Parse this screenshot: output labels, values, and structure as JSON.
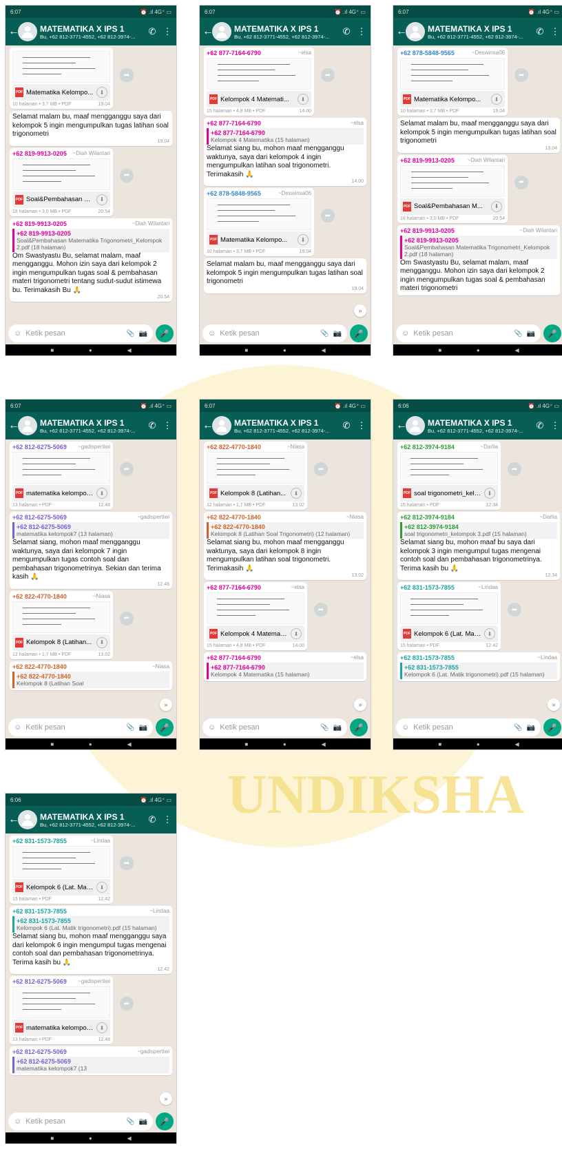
{
  "watermark": {
    "text": "UNDIKSHA",
    "color": "#f6df88"
  },
  "common": {
    "title": "MATEMATIKA X IPS 1",
    "subtitle": "Bu, +62 812-3771-4552, +62 812-3974-...",
    "input_placeholder": "Ketik pesan",
    "status_time": "6:07",
    "status_right": "⏰ .ıl 4G⁺ ▭"
  },
  "phones": [
    {
      "status_time": "6:07",
      "messages": [
        {
          "kind": "doc",
          "color": "#e07000",
          "sender": "",
          "alias": "",
          "doc": "Matematika Kelompo...",
          "meta": "10 halaman • 3,7 MB • PDF",
          "time": "19.04"
        },
        {
          "kind": "text",
          "text": "Selamat malam bu, maaf mengganggu saya dari kelompok 5 ingin mengumpulkan tugas latihan soal trigonometri",
          "time": "19.04"
        },
        {
          "kind": "doc",
          "color": "#e0009a",
          "sender": "+62 819-9913-0205",
          "alias": "~Diah Wilantari",
          "doc": "Soal&Pembahasan M...",
          "meta": "18 halaman • 3,0 MB • PDF",
          "time": "20.54"
        },
        {
          "kind": "reply",
          "color": "#e0009a",
          "sender": "+62 819-9913-0205",
          "alias": "~Diah Wilantari",
          "q_sender": "+62 819-9913-0205",
          "q_text": "Soal&Pembahasan Matematika Trigonometri_Kelompok 2.pdf (18 halaman)",
          "text": "Om Swastyastu Bu, selamat malam, maaf mengganggu. Mohon izin saya dari kelompok 2 ingin mengumpulkan tugas soal & pembahasan materi trigonometri tentang sudut-sudut istimewa bu. Terimakasih Bu 🙏",
          "time": "20.54"
        }
      ]
    },
    {
      "status_time": "6:07",
      "messages": [
        {
          "kind": "doc",
          "color": "#e0009a",
          "sender": "+62 877-7164-6790",
          "alias": "~elsa",
          "doc": "Kelompok 4 Matemati...",
          "meta": "15 halaman • 4,8 MB • PDF",
          "time": "14.00"
        },
        {
          "kind": "reply",
          "color": "#e0009a",
          "sender": "+62 877-7164-6790",
          "alias": "~elsa",
          "q_sender": "+62 877-7164-6790",
          "q_text": "Kelompok 4 Matematika (15 halaman)",
          "text": "Selamat siang bu, mohon maaf mengganggu waktunya, saya dari kelompok 4 ingin mengumpulkan latihan soal trigonometri. Terimakasih 🙏",
          "time": "14.00"
        },
        {
          "kind": "doc",
          "color": "#3a86c8",
          "sender": "+62 878-5848-9565",
          "alias": "~Deswinsa06",
          "doc": "Matematika Kelompo...",
          "meta": "10 halaman • 3,7 MB • PDF",
          "time": "19.04"
        },
        {
          "kind": "text",
          "text": "Selamat malam bu, maaf mengganggu saya dari kelompok 5 ingin mengumpulkan tugas latihan soal trigonometri",
          "time": "19.04"
        }
      ]
    },
    {
      "status_time": "6:07",
      "messages": [
        {
          "kind": "doc",
          "color": "#3a86c8",
          "sender": "+62 878-5848-9565",
          "alias": "~Deswinsa06",
          "doc": "Matematika Kelompo...",
          "meta": "10 halaman • 3,7 MB • PDF",
          "time": "19.04"
        },
        {
          "kind": "text",
          "text": "Selamat malam bu, maaf mengganggu saya dari kelompok 5 ingin mengumpulkan tugas latihan soal trigonometri",
          "time": "19.04"
        },
        {
          "kind": "doc",
          "color": "#e0009a",
          "sender": "+62 819-9913-0205",
          "alias": "~Diah Wilantari",
          "doc": "Soal&Pembahasan M...",
          "meta": "18 halaman • 3,0 MB • PDF",
          "time": "20.54"
        },
        {
          "kind": "reply",
          "color": "#e0009a",
          "sender": "+62 819-9913-0205",
          "alias": "~Diah Wilantari",
          "q_sender": "+62 819-9913-0205",
          "q_text": "Soal&Pembahasan Matematika Trigonometri_Kelompok 2.pdf (18 halaman)",
          "text": "Om Swastyastu Bu, selamat malam, maaf mengganggu. Mohon izin saya dari kelompok 2 ingin mengumpulkan tugas soal & pembahasan materi trigonometri",
          "time": ""
        }
      ]
    },
    {
      "status_time": "6:07",
      "messages": [
        {
          "kind": "doc",
          "color": "#7b5fd0",
          "sender": "+62 812-6275-5069",
          "alias": "~gadispertiwi",
          "doc": "matematika kelompok7.pdf",
          "meta": "13 halaman • PDF",
          "time": "12.48"
        },
        {
          "kind": "reply",
          "color": "#7b5fd0",
          "sender": "+62 812-6275-5069",
          "alias": "~gadispertiwi",
          "q_sender": "+62 812-6275-5069",
          "q_text": "matematika kelompok7 (13 halaman)",
          "text": "Selamat siang, mohon maaf mengganggu waktunya, saya dari kelompok 7 ingin mengumpulkan tugas contoh soal dan pembahasan trigonometrinya. Sekian dan terima kasih 🙏",
          "time": "12.48"
        },
        {
          "kind": "doc",
          "color": "#d0622b",
          "sender": "+62 822-4770-1840",
          "alias": "~Niasa",
          "doc": "Kelompok 8 (Latihan...",
          "meta": "12 halaman • 1,7 MB • PDF",
          "time": "13.02"
        },
        {
          "kind": "reply",
          "color": "#d0622b",
          "sender": "+62 822-4770-1840",
          "alias": "~Niasa",
          "q_sender": "+62 822-4770-1840",
          "q_text": "Kelompok 8 (Latihan Soal",
          "text": "",
          "time": ""
        }
      ]
    },
    {
      "status_time": "6:07",
      "messages": [
        {
          "kind": "doc",
          "color": "#d0622b",
          "sender": "+62 822-4770-1840",
          "alias": "~Niasa",
          "doc": "Kelompok 8 (Latihan...",
          "meta": "12 halaman • 1,7 MB • PDF",
          "time": "13.02"
        },
        {
          "kind": "reply",
          "color": "#d0622b",
          "sender": "+62 822-4770-1840",
          "alias": "~Niasa",
          "q_sender": "+62 822-4770-1840",
          "q_text": "Kelompok 8 (Latihan Soal Trigonometri) (12 halaman)",
          "text": "Selamat siang bu, mohon maaf mengganggu waktunya, saya dari kelompok 8 ingin mengumpulkan latihan soal trigonometri. Terimakasih 🙏",
          "time": "13.02"
        },
        {
          "kind": "doc",
          "color": "#e0009a",
          "sender": "+62 877-7164-6790",
          "alias": "~elsa",
          "doc": "Kelompok 4 Matemati...",
          "meta": "15 halaman • 4,8 MB • PDF",
          "time": "14.00"
        },
        {
          "kind": "reply",
          "color": "#e0009a",
          "sender": "+62 877-7164-6790",
          "alias": "~elsa",
          "q_sender": "+62 877-7164-6790",
          "q_text": "Kelompok 4 Matematika (15 halaman)",
          "text": "",
          "time": ""
        }
      ]
    },
    {
      "status_time": "6:06",
      "messages": [
        {
          "kind": "doc",
          "color": "#2e9b35",
          "sender": "+62 812-3974-9184",
          "alias": "~Darlia",
          "doc": "soal trigonometri_kelompok...",
          "meta": "15 halaman • PDF",
          "time": "12.34"
        },
        {
          "kind": "reply",
          "color": "#2e9b35",
          "sender": "+62 812-3974-9184",
          "alias": "~Darlia",
          "q_sender": "+62 812-3974-9184",
          "q_text": "soal trigonometri_kelompok 3.pdf (15 halaman)",
          "text": "Selamat siang bu, mohon maaf bu saya dari kelompok 3 ingin mengumpul tugas mengenai contoh soal dan pembahasan trigonometrinya. Terima kasih bu 🙏",
          "time": "12.34"
        },
        {
          "kind": "doc",
          "color": "#1ba4a4",
          "sender": "+62 831-1573-7855",
          "alias": "~Lindaa",
          "doc": "Kelompok 6 (Lat. Matik trigo...",
          "meta": "15 halaman • PDF",
          "time": "12.42"
        },
        {
          "kind": "reply",
          "color": "#1ba4a4",
          "sender": "+62 831-1573-7855",
          "alias": "~Lindaa",
          "q_sender": "+62 831-1573-7855",
          "q_text": "Kelompok 6 (Lat. Matik trigonometri).pdf (15 halaman)",
          "text": "",
          "time": ""
        }
      ]
    },
    {
      "status_time": "6:06",
      "messages": [
        {
          "kind": "doc",
          "color": "#1ba4a4",
          "sender": "+62 831-1573-7855",
          "alias": "~Lindaa",
          "doc": "Kelompok 6 (Lat. Matik trigo...",
          "meta": "15 halaman • PDF",
          "time": "12.42"
        },
        {
          "kind": "reply",
          "color": "#1ba4a4",
          "sender": "+62 831-1573-7855",
          "alias": "~Lindaa",
          "q_sender": "+62 831-1573-7855",
          "q_text": "Kelompok 6 (Lat. Matik trigonometri).pdf (15 halaman)",
          "text": "Selamat siang bu, mohon maaf mengganggu saya dari kelompok 6 ingin mengumpul tugas mengenai contoh soal dan pembahasan trigonometrinya. Terima kasih bu 🙏",
          "time": "12.42"
        },
        {
          "kind": "doc",
          "color": "#7b5fd0",
          "sender": "+62 812-6275-5069",
          "alias": "~gadispertiwi",
          "doc": "matematika kelompok7.pdf",
          "meta": "13 halaman • PDF",
          "time": "12.48"
        },
        {
          "kind": "reply",
          "color": "#7b5fd0",
          "sender": "+62 812-6275-5069",
          "alias": "~gadispertiwi",
          "q_sender": "+62 812-6275-5069",
          "q_text": "matematika kelompok7 (13",
          "text": "",
          "time": ""
        }
      ]
    }
  ]
}
